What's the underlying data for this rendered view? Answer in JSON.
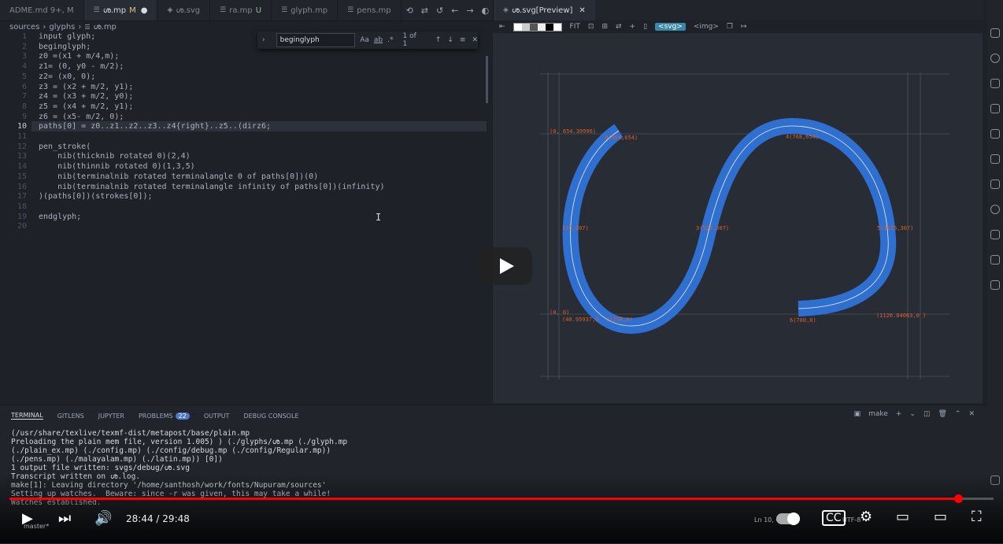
{
  "tabs": [
    {
      "label": "ADME.md 9+, M",
      "active": false
    },
    {
      "label": "ശ.mp",
      "status": "M",
      "dirty": true,
      "active": true
    },
    {
      "label": "ശ.svg",
      "active": false
    },
    {
      "label": "ra.mp",
      "status": "U",
      "active": false
    },
    {
      "label": "glyph.mp",
      "active": false
    },
    {
      "label": "pens.mp",
      "active": false
    }
  ],
  "breadcrumb": [
    "sources",
    "glyphs",
    "ശ.mp"
  ],
  "find": {
    "query": "beginglyph",
    "count": "1 of 1",
    "opt_case": "Aa",
    "opt_word": "ab",
    "opt_regex": ".*"
  },
  "code_lines": [
    {
      "n": "1",
      "text": "input glyph;"
    },
    {
      "n": "2",
      "text": "beginglyph;"
    },
    {
      "n": "3",
      "text": "z0 =(x1 + m/4,m);"
    },
    {
      "n": "4",
      "text": "z1= (0, y0 - m/2);"
    },
    {
      "n": "5",
      "text": "z2= (x0, 0);"
    },
    {
      "n": "6",
      "text": "z3 = (x2 + m/2, y1);"
    },
    {
      "n": "7",
      "text": "z4 = (x3 + m/2, y0);"
    },
    {
      "n": "8",
      "text": "z5 = (x4 + m/2, y1);"
    },
    {
      "n": "9",
      "text": "z6 = (x5- m/2, 0);"
    },
    {
      "n": "10",
      "text": "paths[0] = z0..z1..z2..z3..z4{right}..z5..(dirz6;"
    },
    {
      "n": "11",
      "text": ""
    },
    {
      "n": "12",
      "text": "pen_stroke("
    },
    {
      "n": "13",
      "text": "    nib(thicknib rotated 0)(2,4)"
    },
    {
      "n": "14",
      "text": "    nib(thinnib rotated 0)(1,3,5)"
    },
    {
      "n": "15",
      "text": "    nib(terminalnib rotated terminalangle 0 of paths[0])(0)"
    },
    {
      "n": "16",
      "text": "    nib(terminalnib rotated terminalangle infinity of paths[0])(infinity)"
    },
    {
      "n": "17",
      "text": ")(paths[0])(strokes[0]);"
    },
    {
      "n": "18",
      "text": ""
    },
    {
      "n": "19",
      "text": "endglyph;"
    },
    {
      "n": "20",
      "text": ""
    }
  ],
  "preview": {
    "tab_label": "ശ.svg[Preview]",
    "toolbar": {
      "fit": "FIT",
      "svg_tag": "<svg>",
      "img_tag": "<img>"
    },
    "stroke_color": "#2f6fd0",
    "label_color": "#d9622b",
    "labels": [
      {
        "id": "top-left",
        "text": "(0, 654.39996)"
      },
      {
        "id": "p0",
        "text": "0(354,654)"
      },
      {
        "id": "p4",
        "text": "4(768,654)"
      },
      {
        "id": "p1",
        "text": "1(0,307)"
      },
      {
        "id": "p3",
        "text": "3(523,307)"
      },
      {
        "id": "p5",
        "text": "5(1025,307)"
      },
      {
        "id": "origin",
        "text": "(0, 0)"
      },
      {
        "id": "start",
        "text": "(40.95937,0"
      },
      {
        "id": "p2",
        "text": "2(258,0)"
      },
      {
        "id": "p6",
        "text": "6(780,0)"
      },
      {
        "id": "right",
        "text": "(1126.04063,0 )"
      }
    ]
  },
  "panel": {
    "tabs": [
      {
        "label": "TERMINAL",
        "active": true
      },
      {
        "label": "GITLENS"
      },
      {
        "label": "JUPYTER"
      },
      {
        "label": "PROBLEMS",
        "badge": "22"
      },
      {
        "label": "OUTPUT"
      },
      {
        "label": "DEBUG CONSOLE"
      }
    ],
    "shell": "make",
    "terminal": [
      "(/usr/share/texlive/texmf-dist/metapost/base/plain.mp",
      "Preloading the plain mem file, version 1.005) ) (./glyphs/ശ.mp (./glyph.mp",
      "(./plain_ex.mp) (./config.mp) (./config/debug.mp (./config/Regular.mp))",
      "(./pens.mp) (./malayalam.mp) (./latin.mp)) [0])",
      "1 output file written: svgs/debug/ശ.svg",
      "Transcript written on ശ.log.",
      "make[1]: Leaving directory '/home/santhosh/work/fonts/Nupuram/sources'",
      "Setting up watches.  Beware: since -r was given, this may take a while!",
      "Watches established."
    ]
  },
  "video": {
    "current": "28:44",
    "duration": "29:48",
    "progress": 0.964,
    "time_sep": "/"
  },
  "status": {
    "branch": "master*",
    "position": "Ln 10, Col 2",
    "encoding": "UTF-8"
  }
}
